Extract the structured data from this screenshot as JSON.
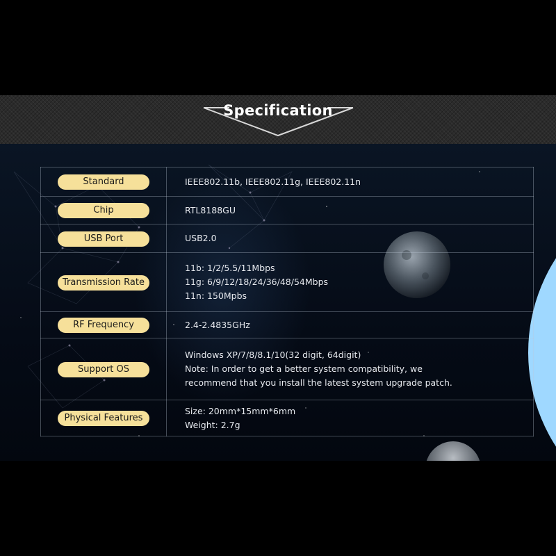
{
  "header": {
    "title": "Specification"
  },
  "specs": [
    {
      "label": "Standard",
      "lines": [
        "IEEE802.11b, IEEE802.11g, IEEE802.11n"
      ]
    },
    {
      "label": "Chip",
      "lines": [
        "RTL8188GU"
      ]
    },
    {
      "label": "USB Port",
      "lines": [
        "USB2.0"
      ]
    },
    {
      "label": "Transmission Rate",
      "lines": [
        "11b: 1/2/5.5/11Mbps",
        "11g: 6/9/12/18/24/36/48/54Mbps",
        "11n: 150Mpbs"
      ]
    },
    {
      "label": "RF Frequency",
      "lines": [
        "2.4-2.4835GHz"
      ]
    },
    {
      "label": "Support OS",
      "lines": [
        "Windows XP/7/8/8.1/10(32 digit, 64digit)",
        "Note: In order to get a better system compatibility, we",
        "recommend that you install the latest system upgrade patch."
      ]
    },
    {
      "label": "Physical Features",
      "lines": [
        "Size: 20mm*15mm*6mm",
        "Weight: 2.7g"
      ]
    }
  ],
  "colors": {
    "pill": "#f6e09a",
    "banner": "#2b2b2b",
    "background": "#000000"
  }
}
